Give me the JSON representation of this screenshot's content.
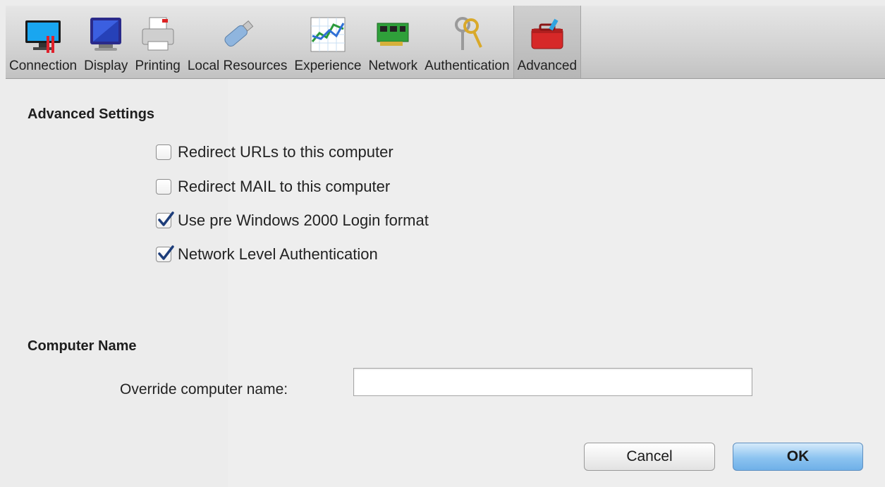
{
  "toolbar": {
    "tabs": [
      {
        "label": "Connection",
        "icon": "connection-monitor-icon"
      },
      {
        "label": "Display",
        "icon": "display-monitor-icon"
      },
      {
        "label": "Printing",
        "icon": "printer-icon"
      },
      {
        "label": "Local Resources",
        "icon": "usb-drive-icon"
      },
      {
        "label": "Experience",
        "icon": "graph-chart-icon"
      },
      {
        "label": "Network",
        "icon": "network-card-icon"
      },
      {
        "label": "Authentication",
        "icon": "keys-icon"
      },
      {
        "label": "Advanced",
        "icon": "toolbox-icon"
      }
    ],
    "selected": "Advanced"
  },
  "advanced": {
    "heading": "Advanced Settings",
    "options": [
      {
        "label": "Redirect URLs to this computer",
        "checked": false
      },
      {
        "label": "Redirect MAIL to this computer",
        "checked": false
      },
      {
        "label": "Use pre Windows 2000 Login format",
        "checked": true
      },
      {
        "label": "Network Level Authentication",
        "checked": true
      }
    ]
  },
  "computer_name": {
    "heading": "Computer Name",
    "override_label": "Override computer name:",
    "override_value": ""
  },
  "buttons": {
    "cancel": "Cancel",
    "ok": "OK"
  },
  "colors": {
    "accent_button": "#8cc3f0",
    "toolbar_bg": "#d2d2d2",
    "window_bg": "#ececec"
  }
}
